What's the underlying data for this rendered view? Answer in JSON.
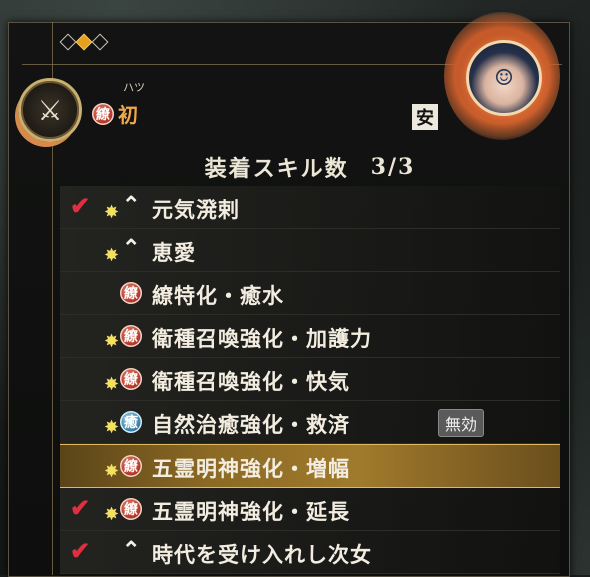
{
  "header": {
    "rank_ruby": "ハツ",
    "rank_badge": "繚",
    "rank_text": "初",
    "safe_tag": "安",
    "page_indicator": {
      "total": 3,
      "active_index": 1
    }
  },
  "skills_title": {
    "label": "装着スキル数",
    "count": "3/3"
  },
  "skills": [
    {
      "equipped": true,
      "star": true,
      "icon": "chevron",
      "badge": "",
      "badge_color": "",
      "label": "元気溌剌",
      "status": ""
    },
    {
      "equipped": false,
      "star": true,
      "icon": "chevron",
      "badge": "",
      "badge_color": "",
      "label": "恵愛",
      "status": ""
    },
    {
      "equipped": false,
      "star": false,
      "icon": "badge",
      "badge": "繚",
      "badge_color": "red",
      "label": "繚特化・癒水",
      "status": ""
    },
    {
      "equipped": false,
      "star": true,
      "icon": "badge",
      "badge": "繚",
      "badge_color": "red",
      "label": "衛種召喚強化・加護力",
      "status": ""
    },
    {
      "equipped": false,
      "star": true,
      "icon": "badge",
      "badge": "繚",
      "badge_color": "red",
      "label": "衛種召喚強化・快気",
      "status": ""
    },
    {
      "equipped": false,
      "star": true,
      "icon": "badge",
      "badge": "癒",
      "badge_color": "blue",
      "label": "自然治癒強化・救済",
      "status": "無効"
    },
    {
      "equipped": false,
      "star": true,
      "icon": "badge",
      "badge": "繚",
      "badge_color": "red",
      "label": "五霊明神強化・増幅",
      "status": "",
      "selected": true
    },
    {
      "equipped": true,
      "star": true,
      "icon": "badge",
      "badge": "繚",
      "badge_color": "red",
      "label": "五霊明神強化・延長",
      "status": ""
    },
    {
      "equipped": true,
      "star": false,
      "icon": "chevron",
      "badge": "",
      "badge_color": "",
      "label": "時代を受け入れし次女",
      "status": ""
    }
  ],
  "icons": {
    "check": "✔",
    "star": "✸",
    "chevron": "⌃",
    "weapon": "⚔"
  }
}
